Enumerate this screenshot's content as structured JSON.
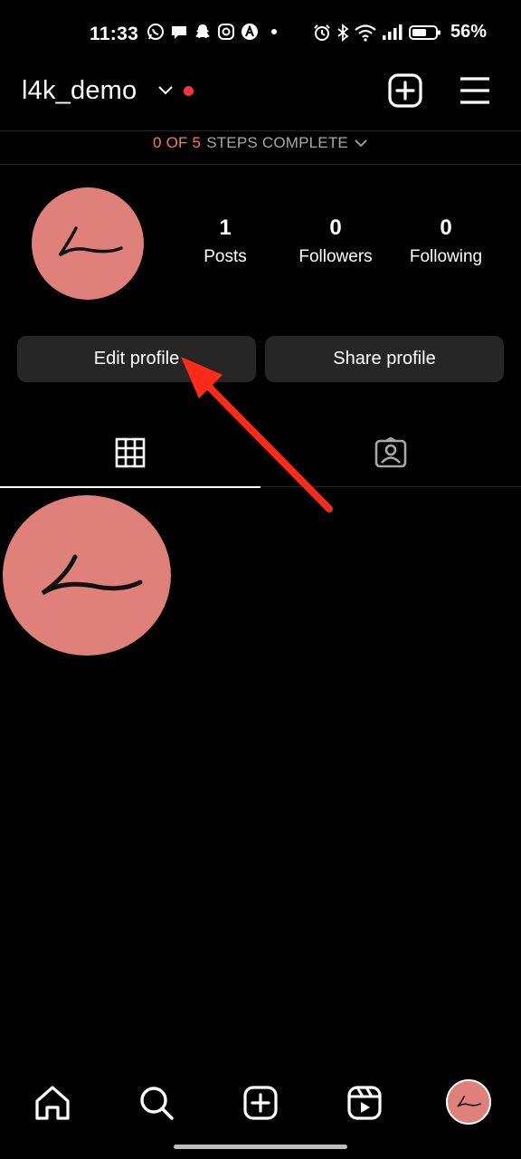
{
  "status_bar": {
    "time": "11:33",
    "battery_percent": "56%"
  },
  "header": {
    "username": "l4k_demo",
    "chevron_icon": "chevron-down-icon",
    "notification_color": "#ff3040",
    "add_icon": "add-square-icon",
    "menu_icon": "hamburger-menu-icon"
  },
  "steps": {
    "progress": "0 OF 5",
    "label": "STEPS COMPLETE"
  },
  "profile": {
    "avatar_color": "#e0807a",
    "stats": [
      {
        "value": "1",
        "label": "Posts"
      },
      {
        "value": "0",
        "label": "Followers"
      },
      {
        "value": "0",
        "label": "Following"
      }
    ],
    "edit_label": "Edit profile",
    "share_label": "Share profile"
  },
  "tabs": [
    {
      "icon": "grid-icon",
      "active": true
    },
    {
      "icon": "tagged-person-icon",
      "active": false
    }
  ],
  "annotation": {
    "color": "#ff2a1a",
    "points_to": "Edit profile"
  },
  "bottom_nav": [
    {
      "icon": "home-icon"
    },
    {
      "icon": "search-icon"
    },
    {
      "icon": "create-icon"
    },
    {
      "icon": "reels-icon"
    },
    {
      "icon": "profile-avatar"
    }
  ],
  "colors": {
    "background": "#000000",
    "button_bg": "#262626",
    "accent_orange": "#f2804e",
    "muted_text": "#a8a8a8"
  }
}
